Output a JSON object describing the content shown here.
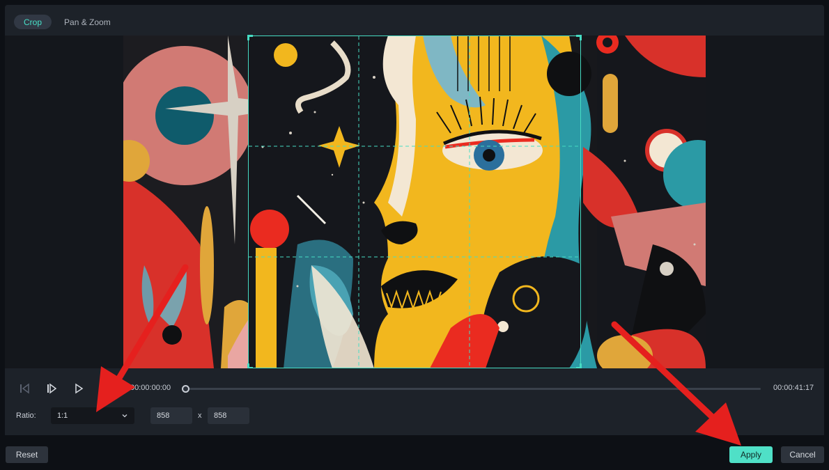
{
  "tabs": [
    {
      "label": "Crop",
      "active": true
    },
    {
      "label": "Pan & Zoom",
      "active": false
    }
  ],
  "player": {
    "current_time": "00:00:00:00",
    "total_time": "00:00:41:17",
    "progress": 0
  },
  "ratio": {
    "label": "Ratio:",
    "selected": "1:1",
    "width": "858",
    "separator": "x",
    "height": "858"
  },
  "buttons": {
    "reset": "Reset",
    "apply": "Apply",
    "cancel": "Cancel"
  },
  "colors": {
    "accent": "#46dcc3",
    "annotation_arrow": "#e5201e"
  },
  "icons": [
    "prev-frame-icon",
    "play-from-start-icon",
    "play-icon",
    "chevron-down-icon"
  ]
}
